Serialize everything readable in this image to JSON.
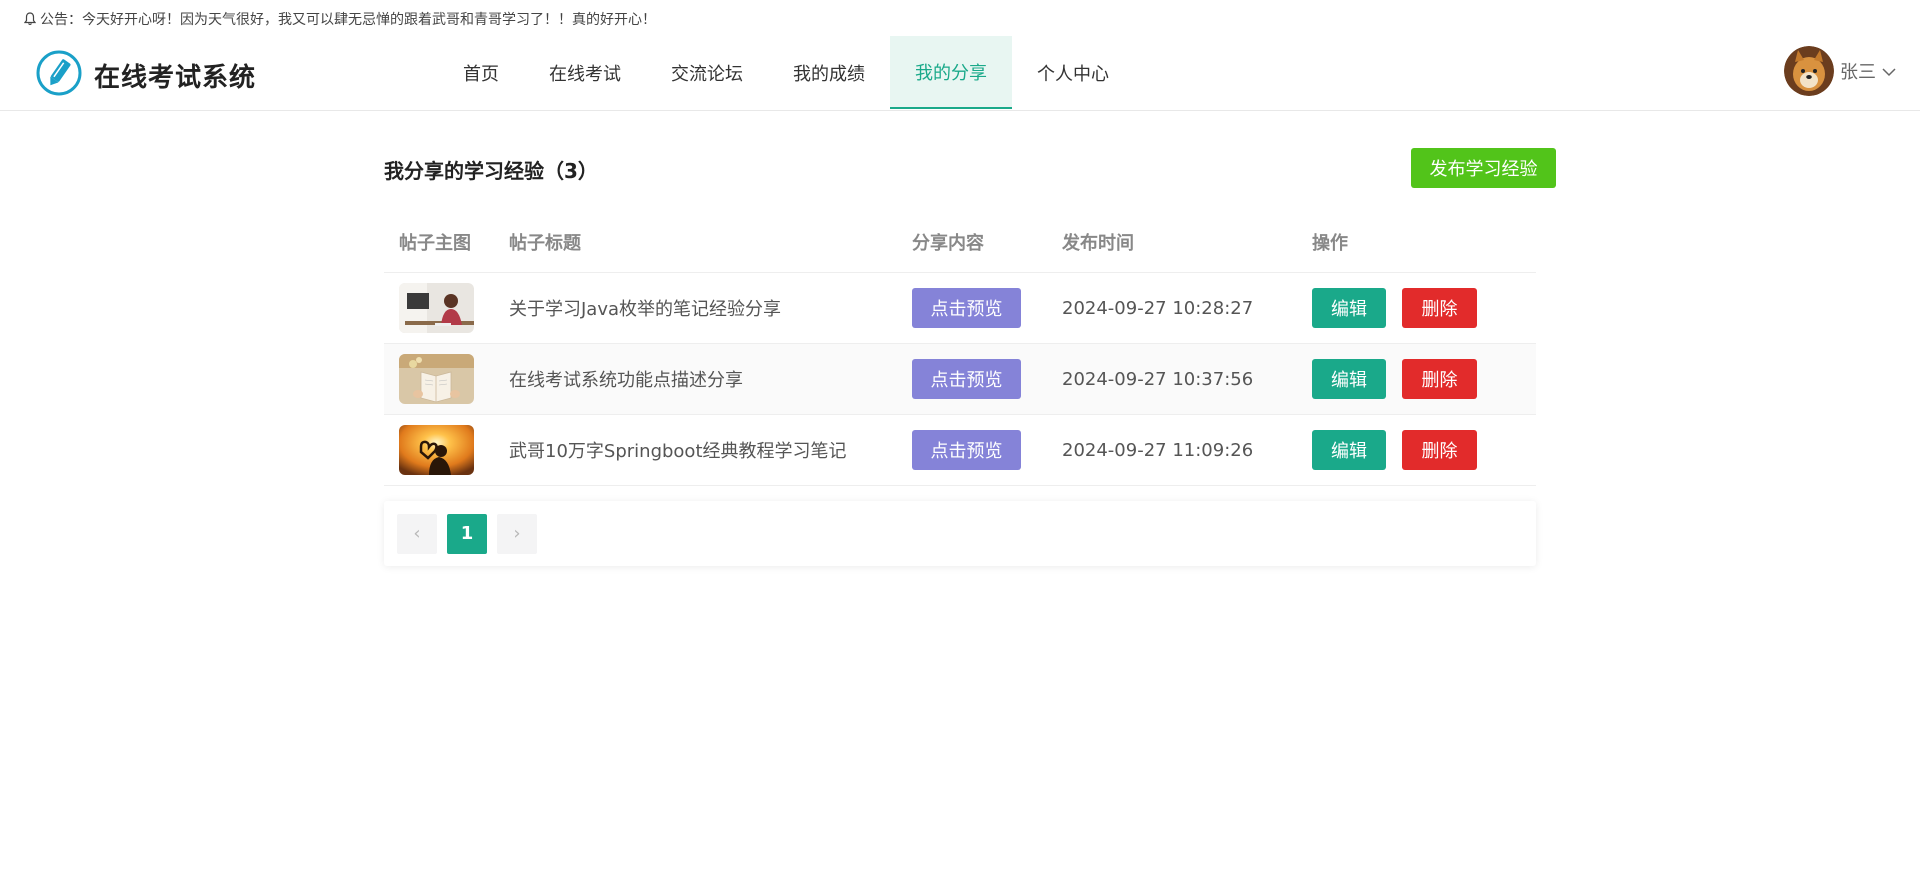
{
  "notice": {
    "icon": "bell-icon",
    "text": "公告：今天好开心呀！因为天气很好，我又可以肆无忌惮的跟着武哥和青哥学习了！！真的好开心！"
  },
  "header": {
    "logo_icon": "pencil-icon",
    "title": "在线考试系统",
    "nav": [
      {
        "label": "首页",
        "active": false
      },
      {
        "label": "在线考试",
        "active": false
      },
      {
        "label": "交流论坛",
        "active": false
      },
      {
        "label": "我的成绩",
        "active": false
      },
      {
        "label": "我的分享",
        "active": true
      },
      {
        "label": "个人中心",
        "active": false
      }
    ],
    "user": {
      "name": "张三",
      "dropdown_icon": "chevron-down-icon"
    }
  },
  "main": {
    "title": "我分享的学习经验（3）",
    "publish_label": "发布学习经验",
    "table": {
      "headers": [
        "帖子主图",
        "帖子标题",
        "分享内容",
        "发布时间",
        "操作"
      ],
      "rows": [
        {
          "title": "关于学习Java枚举的笔记经验分享",
          "preview_label": "点击预览",
          "time": "2024-09-27 10:28:27",
          "edit_label": "编辑",
          "delete_label": "删除"
        },
        {
          "title": "在线考试系统功能点描述分享",
          "preview_label": "点击预览",
          "time": "2024-09-27 10:37:56",
          "edit_label": "编辑",
          "delete_label": "删除"
        },
        {
          "title": "武哥10万字Springboot经典教程学习笔记",
          "preview_label": "点击预览",
          "time": "2024-09-27 11:09:26",
          "edit_label": "编辑",
          "delete_label": "删除"
        }
      ]
    },
    "pagination": {
      "prev": "‹",
      "current": "1",
      "next": "›"
    }
  },
  "colors": {
    "primary": "#1aa98a",
    "publish": "#52c41a",
    "preview": "#8583d8",
    "danger": "#e22b2b",
    "logo": "#1aa0c8"
  }
}
